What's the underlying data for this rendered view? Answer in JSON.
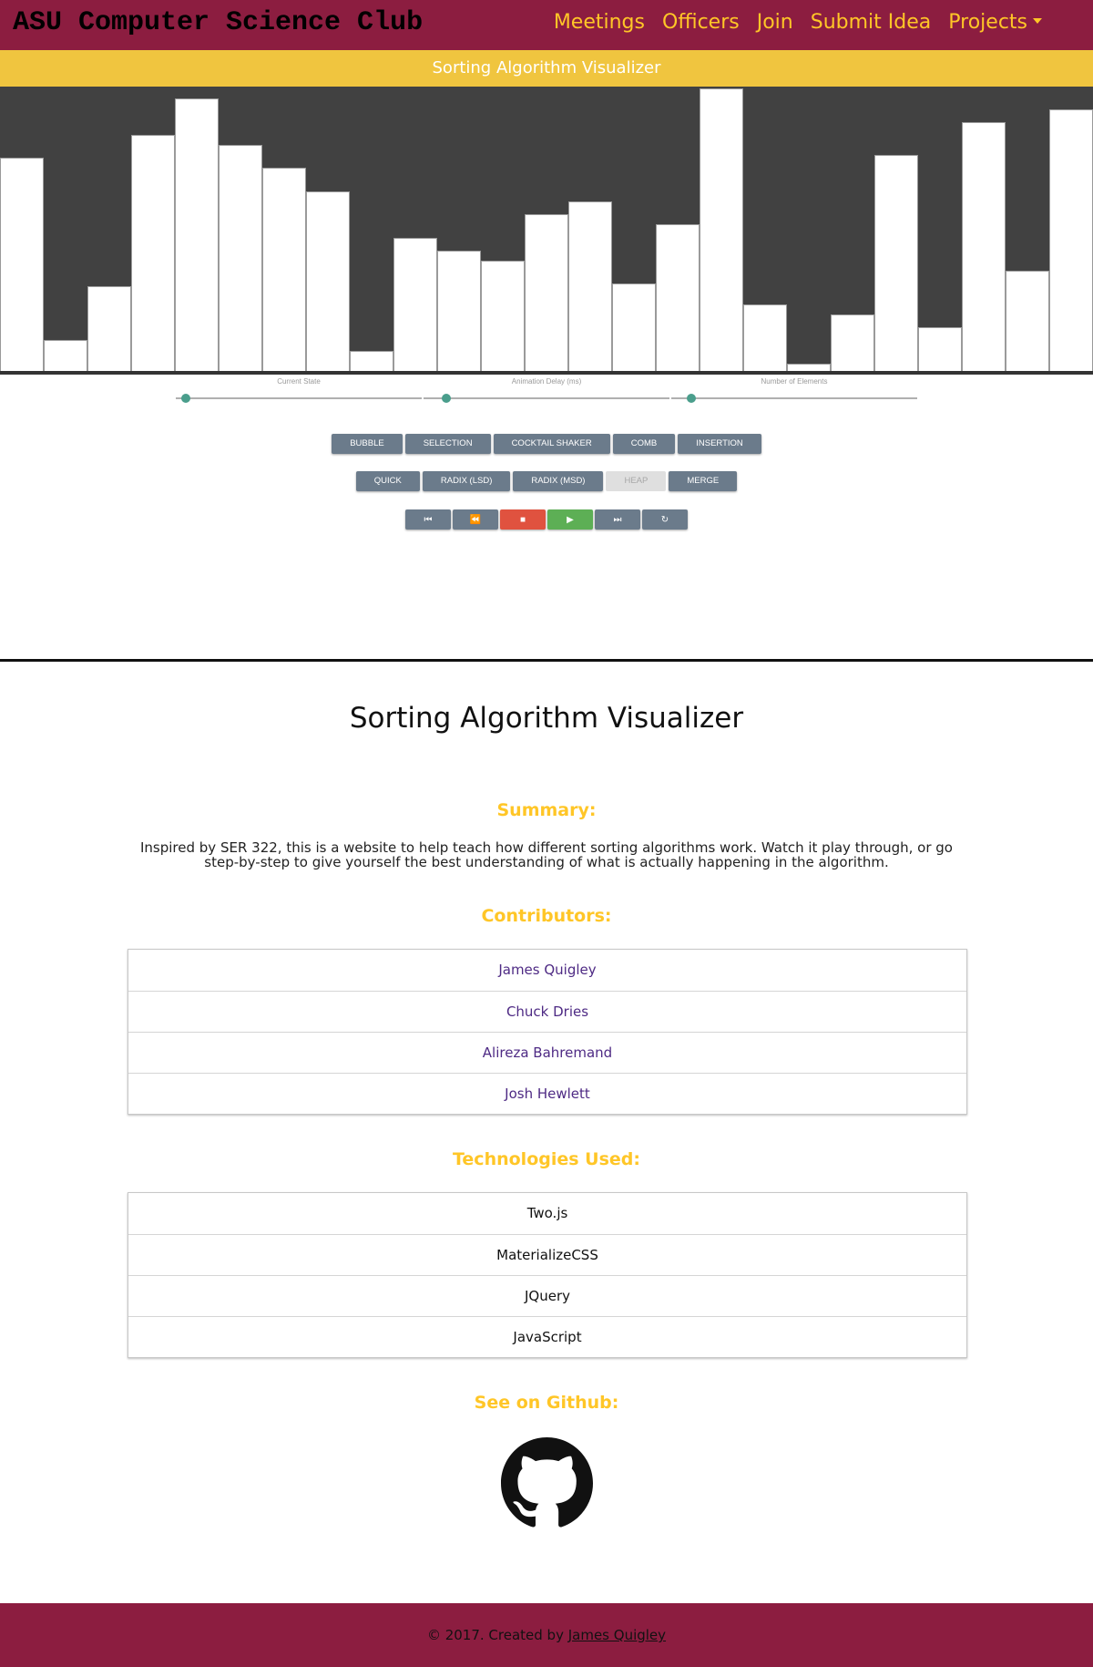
{
  "navbar": {
    "brand": "ASU Computer Science Club",
    "links": [
      "Meetings",
      "Officers",
      "Join",
      "Submit Idea",
      "Projects"
    ],
    "brand_color": "#8c1d40",
    "link_color": "#ffc627"
  },
  "subheader": {
    "title": "Sorting Algorithm Visualizer",
    "color": "#f0c53f"
  },
  "visualizer": {
    "bar_values": [
      84,
      13,
      34,
      93,
      107,
      89,
      80,
      71,
      9,
      53,
      48,
      44,
      62,
      67,
      35,
      58,
      111,
      27,
      4,
      23,
      85,
      18,
      98,
      40,
      103
    ],
    "max_value": 111
  },
  "sliders": [
    {
      "label": "Current State",
      "value": 0
    },
    {
      "label": "Animation Delay (ms)",
      "value": 0
    },
    {
      "label": "Number of Elements",
      "value": 0
    }
  ],
  "algorithms_row1": [
    "BUBBLE",
    "SELECTION",
    "COCKTAIL SHAKER",
    "COMB",
    "INSERTION"
  ],
  "algorithms_row2": [
    "QUICK",
    "RADIX (LSD)",
    "RADIX (MSD)",
    "HEAP",
    "MERGE"
  ],
  "disabled_algorithm": "HEAP",
  "controls": [
    {
      "icon": "skip-start-icon",
      "glyph": "⏮"
    },
    {
      "icon": "rewind-icon",
      "glyph": "⏪"
    },
    {
      "icon": "stop-icon",
      "glyph": "■"
    },
    {
      "icon": "play-icon",
      "glyph": "▶"
    },
    {
      "icon": "skip-end-icon",
      "glyph": "⏭"
    },
    {
      "icon": "replay-icon",
      "glyph": "↻"
    }
  ],
  "info": {
    "title": "Sorting Algorithm Visualizer",
    "summary_heading": "Summary:",
    "summary_text": "Inspired by SER 322, this is a website to help teach how different sorting algorithms work. Watch it play through, or go step-by-step to give yourself the best understanding of what is actually happening in the algorithm.",
    "contributors_heading": "Contributors:",
    "contributors": [
      "James Quigley",
      "Chuck Dries",
      "Alireza Bahremand",
      "Josh Hewlett"
    ],
    "technologies_heading": "Technologies Used:",
    "technologies": [
      "Two.js",
      "MaterializeCSS",
      "JQuery",
      "JavaScript"
    ],
    "github_heading": "See on Github:",
    "github_icon": "github-icon"
  },
  "footer": {
    "text": "© 2017. Created by ",
    "link": "James Quigley"
  }
}
